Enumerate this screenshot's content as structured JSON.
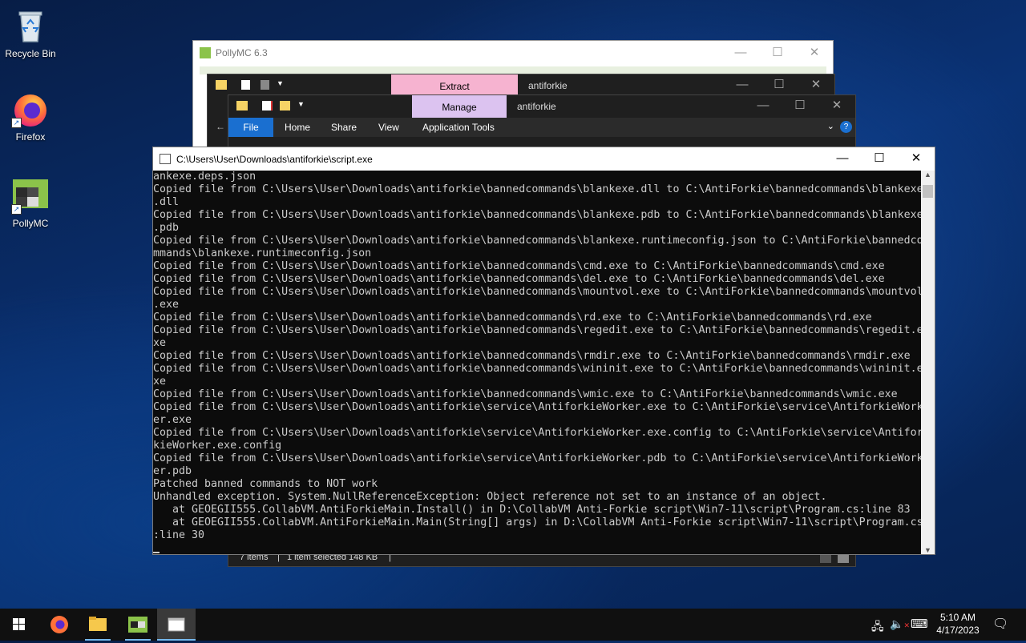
{
  "desktop": {
    "icons": [
      {
        "label": "Recycle Bin",
        "icon": "recycle-bin-icon"
      },
      {
        "label": "Firefox",
        "icon": "firefox-icon"
      },
      {
        "label": "PollyMC",
        "icon": "pollymc-icon"
      }
    ]
  },
  "pollymc_window": {
    "title": "PollyMC 6.3"
  },
  "explorer_back": {
    "context_tab": "Extract",
    "title": "antiforkie"
  },
  "explorer_front": {
    "context_tab": "Manage",
    "title": "antiforkie",
    "ribbon_tabs": [
      "File",
      "Home",
      "Share",
      "View",
      "Application Tools"
    ],
    "status": {
      "items": "7 items",
      "selected": "1 item selected  148 KB"
    }
  },
  "console": {
    "title": "C:\\Users\\User\\Downloads\\antiforkie\\script.exe",
    "lines": [
      "ankexe.deps.json",
      "Copied file from C:\\Users\\User\\Downloads\\antiforkie\\bannedcommands\\blankexe.dll to C:\\AntiForkie\\bannedcommands\\blankexe",
      ".dll",
      "Copied file from C:\\Users\\User\\Downloads\\antiforkie\\bannedcommands\\blankexe.pdb to C:\\AntiForkie\\bannedcommands\\blankexe",
      ".pdb",
      "Copied file from C:\\Users\\User\\Downloads\\antiforkie\\bannedcommands\\blankexe.runtimeconfig.json to C:\\AntiForkie\\bannedco",
      "mmands\\blankexe.runtimeconfig.json",
      "Copied file from C:\\Users\\User\\Downloads\\antiforkie\\bannedcommands\\cmd.exe to C:\\AntiForkie\\bannedcommands\\cmd.exe",
      "Copied file from C:\\Users\\User\\Downloads\\antiforkie\\bannedcommands\\del.exe to C:\\AntiForkie\\bannedcommands\\del.exe",
      "Copied file from C:\\Users\\User\\Downloads\\antiforkie\\bannedcommands\\mountvol.exe to C:\\AntiForkie\\bannedcommands\\mountvol",
      ".exe",
      "Copied file from C:\\Users\\User\\Downloads\\antiforkie\\bannedcommands\\rd.exe to C:\\AntiForkie\\bannedcommands\\rd.exe",
      "Copied file from C:\\Users\\User\\Downloads\\antiforkie\\bannedcommands\\regedit.exe to C:\\AntiForkie\\bannedcommands\\regedit.e",
      "xe",
      "Copied file from C:\\Users\\User\\Downloads\\antiforkie\\bannedcommands\\rmdir.exe to C:\\AntiForkie\\bannedcommands\\rmdir.exe",
      "Copied file from C:\\Users\\User\\Downloads\\antiforkie\\bannedcommands\\wininit.exe to C:\\AntiForkie\\bannedcommands\\wininit.e",
      "xe",
      "Copied file from C:\\Users\\User\\Downloads\\antiforkie\\bannedcommands\\wmic.exe to C:\\AntiForkie\\bannedcommands\\wmic.exe",
      "Copied file from C:\\Users\\User\\Downloads\\antiforkie\\service\\AntiforkieWorker.exe to C:\\AntiForkie\\service\\AntiforkieWork",
      "er.exe",
      "Copied file from C:\\Users\\User\\Downloads\\antiforkie\\service\\AntiforkieWorker.exe.config to C:\\AntiForkie\\service\\Antifor",
      "kieWorker.exe.config",
      "Copied file from C:\\Users\\User\\Downloads\\antiforkie\\service\\AntiforkieWorker.pdb to C:\\AntiForkie\\service\\AntiforkieWork",
      "er.pdb",
      "Patched banned commands to NOT work",
      "Unhandled exception. System.NullReferenceException: Object reference not set to an instance of an object.",
      "   at GEOEGII555.CollabVM.AntiForkieMain.Install() in D:\\CollabVM Anti-Forkie script\\Win7-11\\script\\Program.cs:line 83",
      "   at GEOEGII555.CollabVM.AntiForkieMain.Main(String[] args) in D:\\CollabVM Anti-Forkie script\\Win7-11\\script\\Program.cs",
      ":line 30"
    ]
  },
  "taskbar": {
    "apps": [
      "firefox-icon",
      "file-explorer-icon",
      "pollymc-icon",
      "console-icon"
    ],
    "clock": {
      "time": "5:10 AM",
      "date": "4/17/2023"
    }
  }
}
